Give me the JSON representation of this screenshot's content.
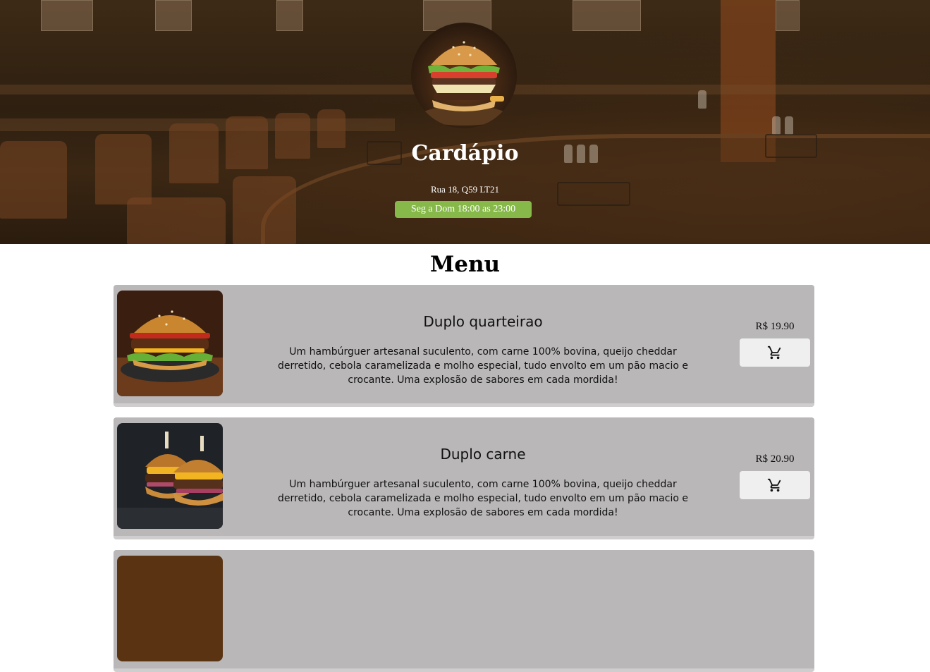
{
  "hero": {
    "title": "Cardápio",
    "address": "Rua 18, Q59 LT21",
    "hours": "Seg a Dom 18:00 as 23:00",
    "hours_badge_color": "#86b94a"
  },
  "menu": {
    "title": "Menu",
    "items": [
      {
        "name": "Duplo quarteirao",
        "description": "Um hambúrguer artesanal suculento, com carne 100% bovina, queijo cheddar derretido, cebola caramelizada e molho especial, tudo envolto em um pão macio e crocante. Uma explosão de sabores em cada mordida!",
        "price": "R$ 19.90",
        "cart_icon": "cart-icon"
      },
      {
        "name": "Duplo carne",
        "description": "Um hambúrguer artesanal suculento, com carne 100% bovina, queijo cheddar derretido, cebola caramelizada e molho especial, tudo envolto em um pão macio e crocante. Uma explosão de sabores em cada mordida!",
        "price": "R$ 20.90",
        "cart_icon": "cart-icon"
      },
      {
        "name": "",
        "description": "",
        "price": "",
        "cart_icon": "cart-icon"
      }
    ]
  },
  "colors": {
    "card_background": "#b9b7b8",
    "cart_button_background": "#efefef"
  }
}
